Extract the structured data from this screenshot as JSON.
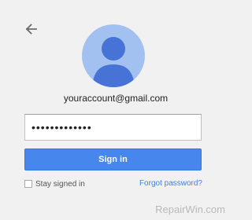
{
  "account": {
    "email": "youraccount@gmail.com"
  },
  "form": {
    "password_value": "•••••••••••••",
    "signin_label": "Sign in",
    "stay_signed_in_label": "Stay signed in",
    "forgot_label": "Forgot password?"
  },
  "watermark": {
    "text": "RepairWin.com"
  },
  "icons": {
    "back": "arrow-left-icon",
    "avatar": "default-user-avatar-icon"
  },
  "colors": {
    "background": "#f1f1f1",
    "avatar_bg": "#a2c1f1",
    "avatar_fg": "#4773d6",
    "primary_button": "#4787ed",
    "link": "#427fed"
  }
}
